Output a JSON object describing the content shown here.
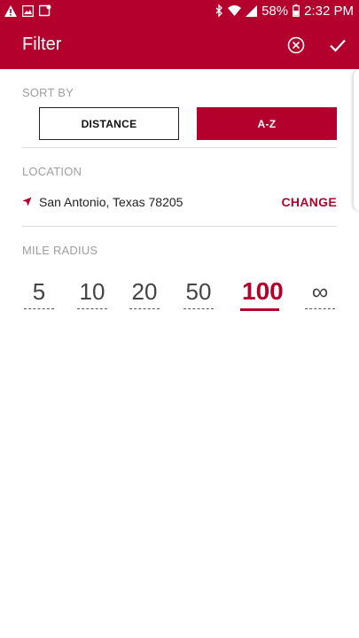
{
  "status_bar": {
    "battery": "58%",
    "time": "2:32 PM",
    "icons": [
      "warning-icon",
      "image-icon",
      "notification-icon",
      "bluetooth-icon",
      "wifi-icon",
      "signal-icon",
      "battery-icon"
    ]
  },
  "app_bar": {
    "title": "Filter",
    "icons": [
      "clear-icon",
      "check-icon"
    ]
  },
  "sort_by": {
    "label": "SORT BY",
    "options": [
      "DISTANCE",
      "A-Z"
    ],
    "selected": "A-Z"
  },
  "location": {
    "label": "LOCATION",
    "value": "San Antonio, Texas 78205",
    "change_label": "CHANGE",
    "icon": "location-arrow-icon"
  },
  "radius": {
    "label": "MILE RADIUS",
    "options": [
      "5",
      "10",
      "20",
      "50",
      "100",
      "∞"
    ],
    "selected": "100"
  },
  "colors": {
    "brand": "#b3002d",
    "label_gray": "#9e9e9e"
  }
}
